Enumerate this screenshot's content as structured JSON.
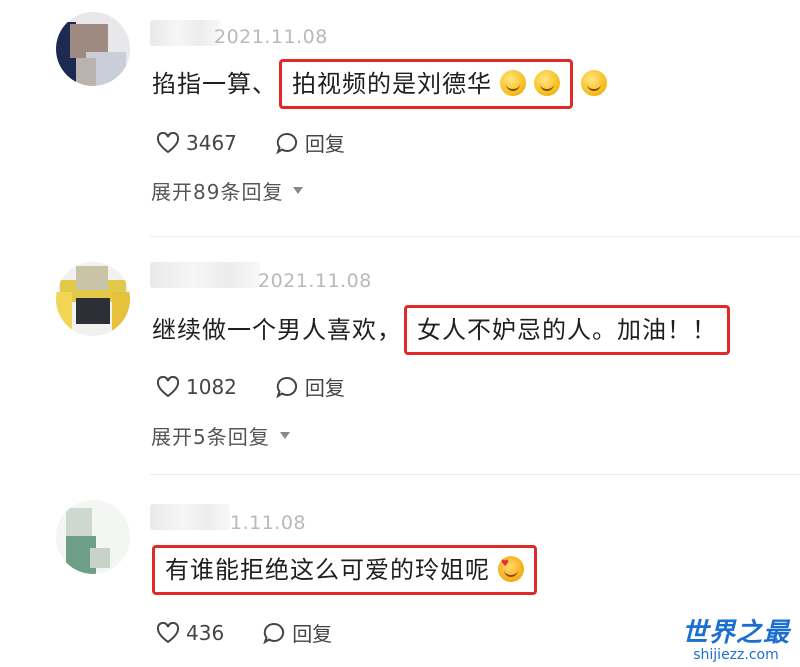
{
  "comments": [
    {
      "date": "2021.11.08",
      "text_prefix": "掐指一算、",
      "text_highlight": "拍视频的是刘德华",
      "likes": "3467",
      "reply_label": "回复",
      "expand": "展开89条回复",
      "emoji": [
        "smirk-emoji",
        "smirk-emoji",
        "smirk-emoji"
      ]
    },
    {
      "date": "2021.11.08",
      "text_prefix": "继续做一个男人喜欢，",
      "text_highlight": "女人不妒忌的人。加油！！",
      "likes": "1082",
      "reply_label": "回复",
      "expand": "展开5条回复"
    },
    {
      "date": "1.11.08",
      "text_prefix": "",
      "text_highlight": "有谁能拒绝这么可爱的玲姐呢",
      "likes": "436",
      "reply_label": "回复",
      "emoji": [
        "love-face-emoji"
      ]
    }
  ],
  "watermark": {
    "title": "世界之最",
    "url": "shijiezz.com"
  },
  "colors": {
    "highlight_border": "#e02a2a",
    "watermark": "#1a6fd1"
  }
}
